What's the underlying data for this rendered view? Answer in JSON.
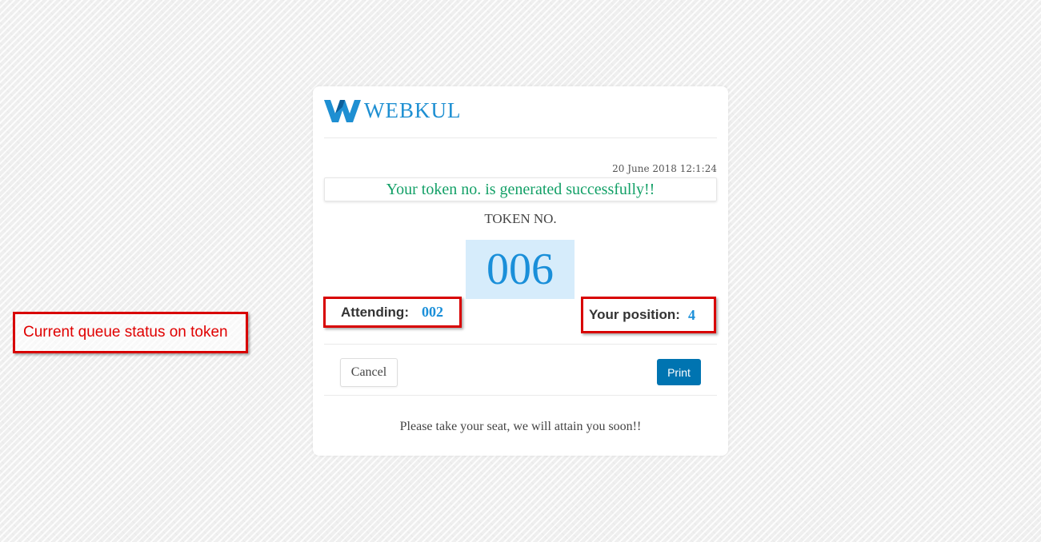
{
  "annotation": {
    "text": "Current queue status on token"
  },
  "card": {
    "logo_text": "WEBKUL",
    "timestamp": "20 June 2018 12:1:24",
    "success_message": "Your token no. is generated successfully!!",
    "token_label": "TOKEN NO.",
    "token_number": "006",
    "attending": {
      "label": "Attending:",
      "value": "002"
    },
    "position": {
      "label": "Your position:",
      "value": "4"
    },
    "buttons": {
      "cancel_label": "Cancel",
      "print_label": "Print"
    },
    "footer_message": "Please take your seat, we will attain you soon!!"
  },
  "colors": {
    "brand_blue": "#1e8fd2",
    "success_green": "#13a067",
    "print_button": "#0074b1",
    "annotation_red": "#d80000"
  },
  "icons": {
    "logo": "webkul-logo-icon"
  }
}
